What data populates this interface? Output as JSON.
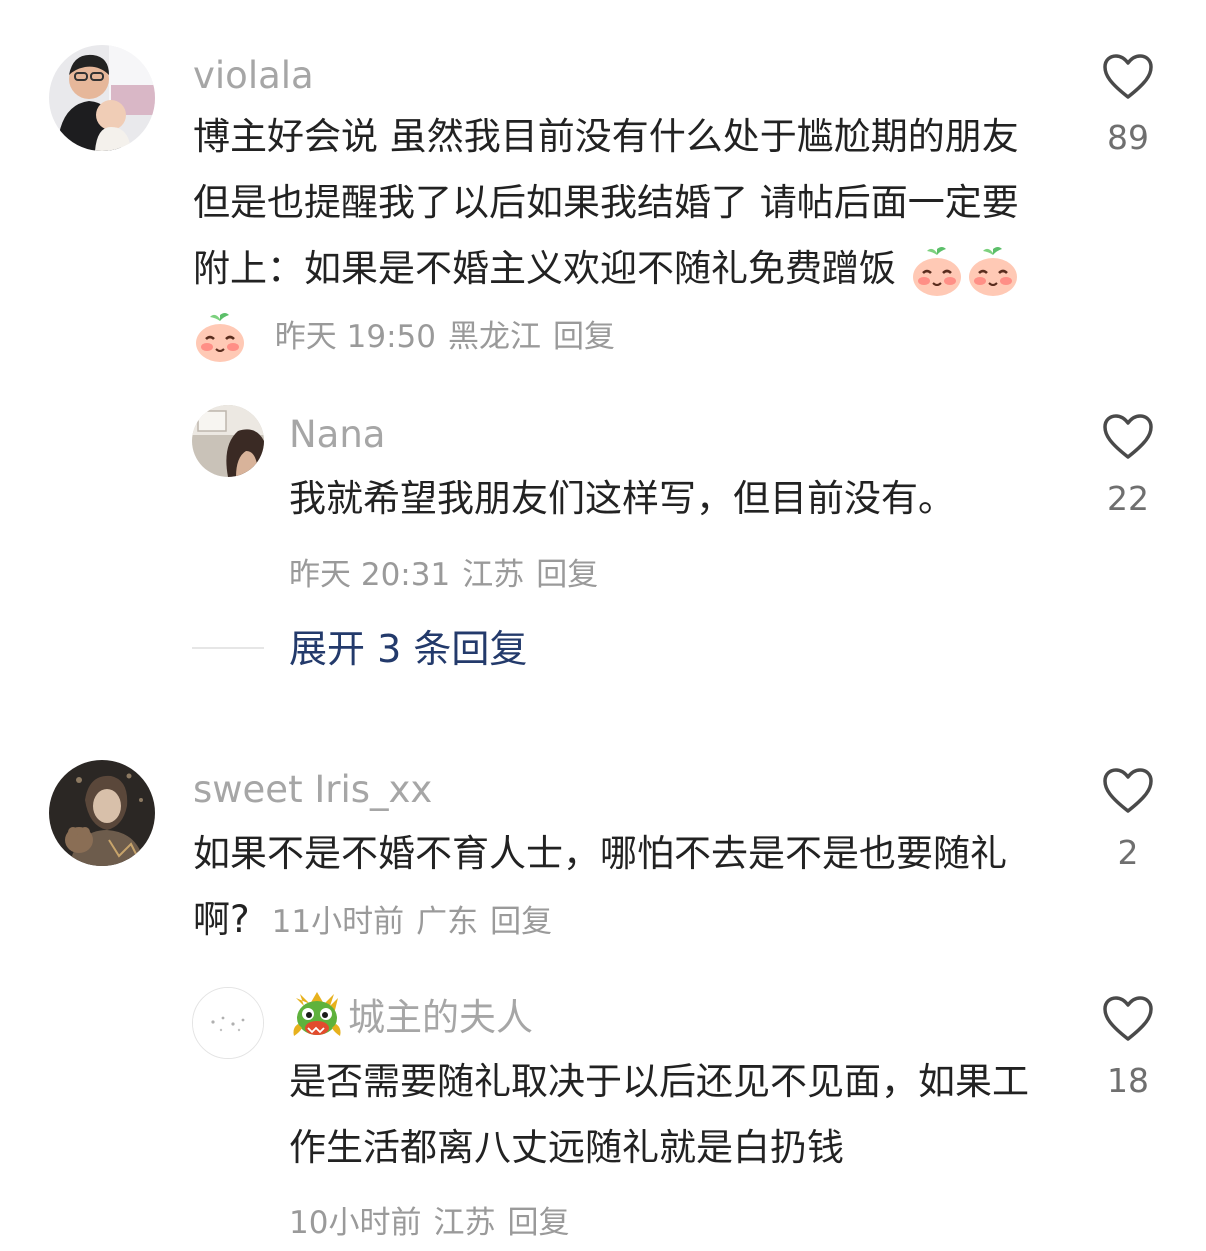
{
  "comments": [
    {
      "username": "violala",
      "text": "博主好会说 虽然我目前没有什么处于尴尬期的朋友 但是也提醒我了以后如果我结婚了 请帖后面一定要附上：如果是不婚主义欢迎不随礼免费蹭饭",
      "emoji_icons": [
        "peach-face-icon",
        "peach-face-icon",
        "peach-face-icon"
      ],
      "time": "昨天 19:50",
      "location": "黑龙江",
      "reply_label": "回复",
      "likes": "89"
    },
    {
      "username": "Nana",
      "text": "我就希望我朋友们这样写，但目前没有。",
      "time": "昨天 20:31",
      "location": "江苏",
      "reply_label": "回复",
      "likes": "22"
    },
    {
      "username": "sweet Iris_xx",
      "text": "如果不是不婚不育人士，哪怕不去是不是也要随礼啊?",
      "time": "11小时前",
      "location": "广东",
      "reply_label": "回复",
      "likes": "2"
    },
    {
      "username": "城主的夫人",
      "badge_icon": "dragon-head-icon",
      "text": "是否需要随礼取决于以后还见不见面，如果工作生活都离八丈远随礼就是白扔钱",
      "time": "10小时前",
      "location": "江苏",
      "reply_label": "回复",
      "likes": "18"
    }
  ],
  "expand_replies": {
    "label": "展开 3 条回复"
  },
  "icons": {
    "like": "heart-outline-icon"
  },
  "colors": {
    "username": "#a6a6a6",
    "body_text": "#222222",
    "meta_text": "#9a9a9a",
    "like_count": "#6f6f6f",
    "expand_link": "#233a6b"
  }
}
